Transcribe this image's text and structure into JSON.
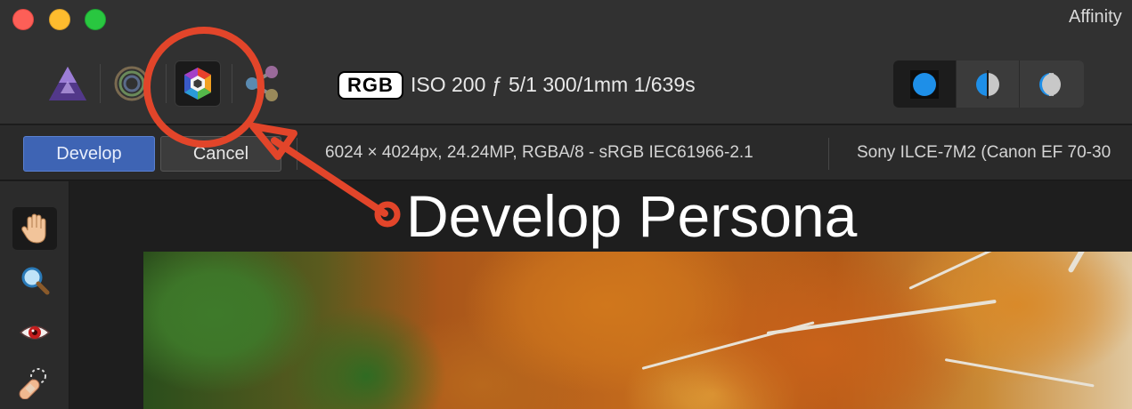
{
  "window": {
    "title": "Affinity"
  },
  "toolbar": {
    "personas": [
      {
        "name": "Photo Persona",
        "icon": "affinity-photo-icon",
        "selected": false
      },
      {
        "name": "Liquify Persona",
        "icon": "liquify-icon",
        "selected": false
      },
      {
        "name": "Develop Persona",
        "icon": "develop-persona-icon",
        "selected": true
      },
      {
        "name": "Export Persona",
        "icon": "export-persona-icon",
        "selected": false
      }
    ],
    "color_mode": "RGB",
    "exif": "ISO 200 ƒ 5/1 300/1mm 1/639s",
    "view_modes": [
      {
        "icon": "single-view-icon",
        "selected": true
      },
      {
        "icon": "split-view-icon",
        "selected": false
      },
      {
        "icon": "mirror-view-icon",
        "selected": false
      }
    ]
  },
  "context_bar": {
    "develop_label": "Develop",
    "cancel_label": "Cancel",
    "document_info": "6024 × 4024px, 24.24MP, RGBA/8 - sRGB IEC61966-2.1",
    "camera_info": "Sony ILCE-7M2 (Canon EF 70-30"
  },
  "tools": [
    {
      "icon": "hand-icon",
      "selected": true
    },
    {
      "icon": "zoom-icon",
      "selected": false
    },
    {
      "icon": "red-eye-icon",
      "selected": false
    },
    {
      "icon": "blemish-removal-icon",
      "selected": false
    }
  ],
  "annotation": {
    "label": "Develop Persona",
    "color": "#e2452a"
  },
  "colors": {
    "accent_button": "#3e64b4",
    "annotation": "#e2452a",
    "view_active_blue": "#1e8fe8"
  }
}
